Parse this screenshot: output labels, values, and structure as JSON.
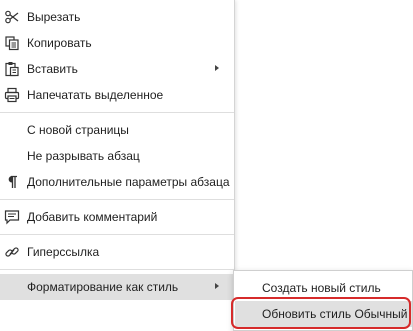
{
  "menu": {
    "cut": "Вырезать",
    "copy": "Копировать",
    "paste": "Вставить",
    "print_selection": "Напечатать выделенное",
    "page_break_before": "С новой страницы",
    "keep_lines_together": "Не разрывать абзац",
    "paragraph_settings": "Дополнительные параметры абзаца",
    "add_comment": "Добавить комментарий",
    "hyperlink": "Гиперссылка",
    "format_as_style": "Форматирование как стиль"
  },
  "submenu": {
    "create_style": "Создать новый стиль",
    "update_style": "Обновить стиль Обычный"
  },
  "colors": {
    "highlight": "#e0e0e0",
    "annotation_ring": "#d62b2b"
  }
}
